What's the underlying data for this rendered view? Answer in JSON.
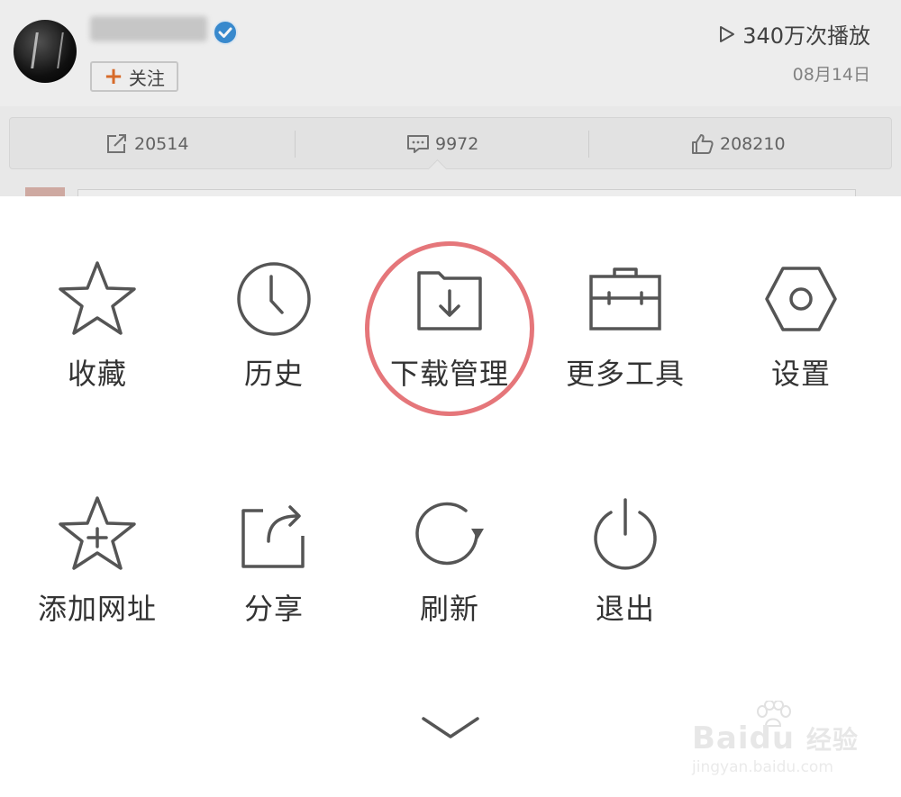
{
  "background_post": {
    "follow_label": "关注",
    "play_count": "340万次播放",
    "date": "08月14日",
    "actions": {
      "repost_count": "20514",
      "comment_count": "9972",
      "like_count": "208210"
    }
  },
  "menu": {
    "row1": [
      {
        "label": "收藏",
        "icon": "star-icon"
      },
      {
        "label": "历史",
        "icon": "clock-icon"
      },
      {
        "label": "下载管理",
        "icon": "download-folder-icon"
      },
      {
        "label": "更多工具",
        "icon": "toolbox-icon"
      },
      {
        "label": "设置",
        "icon": "settings-hex-icon"
      }
    ],
    "row2": [
      {
        "label": "添加网址",
        "icon": "star-plus-icon"
      },
      {
        "label": "分享",
        "icon": "share-icon"
      },
      {
        "label": "刷新",
        "icon": "refresh-icon"
      },
      {
        "label": "退出",
        "icon": "power-icon"
      }
    ],
    "highlighted_item": "下载管理"
  },
  "watermark": {
    "brand": "Bai",
    "brand2": "du",
    "brand_cn": "经验",
    "url": "jingyan.baidu.com"
  },
  "colors": {
    "icon_stroke": "#555555",
    "highlight_ring": "#e5767a",
    "follow_plus": "#e0702c",
    "verified_blue": "#3b8fd6"
  }
}
